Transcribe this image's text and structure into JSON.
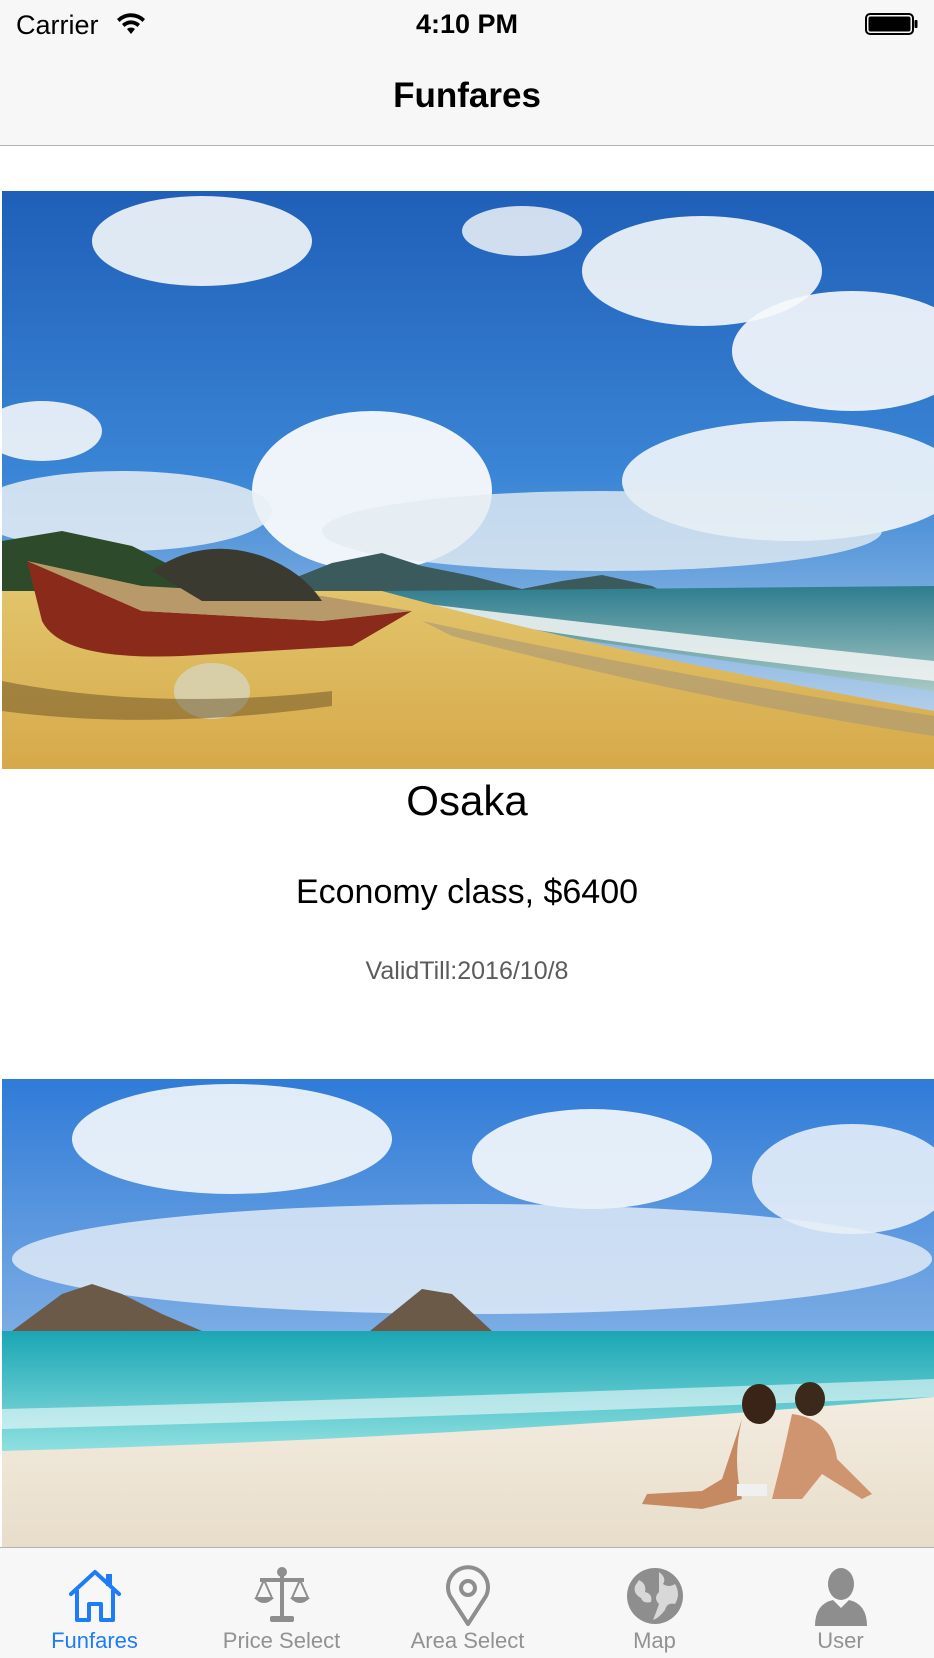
{
  "status_bar": {
    "carrier": "Carrier",
    "time": "4:10 PM"
  },
  "nav": {
    "title": "Funfares"
  },
  "cards": [
    {
      "city": "Osaka",
      "fare": "Economy class, $6400",
      "valid": "ValidTill:2016/10/8",
      "image": "beach-boat-photo"
    },
    {
      "image": "beach-couple-photo"
    }
  ],
  "tab_bar": {
    "active_color": "#1e7cf6",
    "inactive_color": "#929292",
    "tabs": [
      {
        "label": "Funfares",
        "icon": "house-icon",
        "active": true
      },
      {
        "label": "Price Select",
        "icon": "scale-icon",
        "active": false
      },
      {
        "label": "Area Select",
        "icon": "location-pin-icon",
        "active": false
      },
      {
        "label": "Map",
        "icon": "globe-icon",
        "active": false
      },
      {
        "label": "User",
        "icon": "user-icon",
        "active": false
      }
    ]
  }
}
